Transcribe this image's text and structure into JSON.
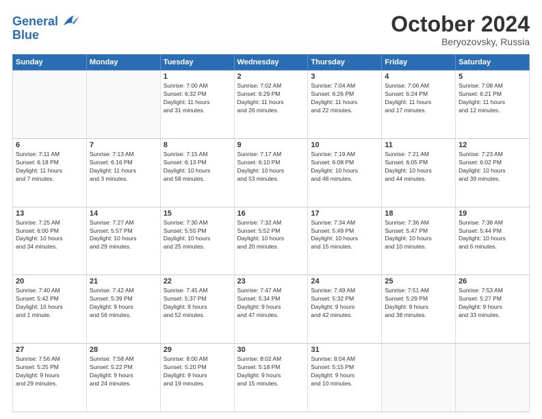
{
  "header": {
    "logo_line1": "General",
    "logo_line2": "Blue",
    "month": "October 2024",
    "location": "Beryozovsky, Russia"
  },
  "days_of_week": [
    "Sunday",
    "Monday",
    "Tuesday",
    "Wednesday",
    "Thursday",
    "Friday",
    "Saturday"
  ],
  "weeks": [
    [
      {
        "day": "",
        "info": ""
      },
      {
        "day": "",
        "info": ""
      },
      {
        "day": "1",
        "info": "Sunrise: 7:00 AM\nSunset: 6:32 PM\nDaylight: 11 hours\nand 31 minutes."
      },
      {
        "day": "2",
        "info": "Sunrise: 7:02 AM\nSunset: 6:29 PM\nDaylight: 11 hours\nand 26 minutes."
      },
      {
        "day": "3",
        "info": "Sunrise: 7:04 AM\nSunset: 6:26 PM\nDaylight: 11 hours\nand 22 minutes."
      },
      {
        "day": "4",
        "info": "Sunrise: 7:06 AM\nSunset: 6:24 PM\nDaylight: 11 hours\nand 17 minutes."
      },
      {
        "day": "5",
        "info": "Sunrise: 7:08 AM\nSunset: 6:21 PM\nDaylight: 11 hours\nand 12 minutes."
      }
    ],
    [
      {
        "day": "6",
        "info": "Sunrise: 7:11 AM\nSunset: 6:18 PM\nDaylight: 11 hours\nand 7 minutes."
      },
      {
        "day": "7",
        "info": "Sunrise: 7:13 AM\nSunset: 6:16 PM\nDaylight: 11 hours\nand 3 minutes."
      },
      {
        "day": "8",
        "info": "Sunrise: 7:15 AM\nSunset: 6:13 PM\nDaylight: 10 hours\nand 58 minutes."
      },
      {
        "day": "9",
        "info": "Sunrise: 7:17 AM\nSunset: 6:10 PM\nDaylight: 10 hours\nand 53 minutes."
      },
      {
        "day": "10",
        "info": "Sunrise: 7:19 AM\nSunset: 6:08 PM\nDaylight: 10 hours\nand 48 minutes."
      },
      {
        "day": "11",
        "info": "Sunrise: 7:21 AM\nSunset: 6:05 PM\nDaylight: 10 hours\nand 44 minutes."
      },
      {
        "day": "12",
        "info": "Sunrise: 7:23 AM\nSunset: 6:02 PM\nDaylight: 10 hours\nand 39 minutes."
      }
    ],
    [
      {
        "day": "13",
        "info": "Sunrise: 7:25 AM\nSunset: 6:00 PM\nDaylight: 10 hours\nand 34 minutes."
      },
      {
        "day": "14",
        "info": "Sunrise: 7:27 AM\nSunset: 5:57 PM\nDaylight: 10 hours\nand 29 minutes."
      },
      {
        "day": "15",
        "info": "Sunrise: 7:30 AM\nSunset: 5:55 PM\nDaylight: 10 hours\nand 25 minutes."
      },
      {
        "day": "16",
        "info": "Sunrise: 7:32 AM\nSunset: 5:52 PM\nDaylight: 10 hours\nand 20 minutes."
      },
      {
        "day": "17",
        "info": "Sunrise: 7:34 AM\nSunset: 5:49 PM\nDaylight: 10 hours\nand 15 minutes."
      },
      {
        "day": "18",
        "info": "Sunrise: 7:36 AM\nSunset: 5:47 PM\nDaylight: 10 hours\nand 10 minutes."
      },
      {
        "day": "19",
        "info": "Sunrise: 7:38 AM\nSunset: 5:44 PM\nDaylight: 10 hours\nand 6 minutes."
      }
    ],
    [
      {
        "day": "20",
        "info": "Sunrise: 7:40 AM\nSunset: 5:42 PM\nDaylight: 10 hours\nand 1 minute."
      },
      {
        "day": "21",
        "info": "Sunrise: 7:42 AM\nSunset: 5:39 PM\nDaylight: 9 hours\nand 56 minutes."
      },
      {
        "day": "22",
        "info": "Sunrise: 7:45 AM\nSunset: 5:37 PM\nDaylight: 9 hours\nand 52 minutes."
      },
      {
        "day": "23",
        "info": "Sunrise: 7:47 AM\nSunset: 5:34 PM\nDaylight: 9 hours\nand 47 minutes."
      },
      {
        "day": "24",
        "info": "Sunrise: 7:49 AM\nSunset: 5:32 PM\nDaylight: 9 hours\nand 42 minutes."
      },
      {
        "day": "25",
        "info": "Sunrise: 7:51 AM\nSunset: 5:29 PM\nDaylight: 9 hours\nand 38 minutes."
      },
      {
        "day": "26",
        "info": "Sunrise: 7:53 AM\nSunset: 5:27 PM\nDaylight: 9 hours\nand 33 minutes."
      }
    ],
    [
      {
        "day": "27",
        "info": "Sunrise: 7:56 AM\nSunset: 5:25 PM\nDaylight: 9 hours\nand 29 minutes."
      },
      {
        "day": "28",
        "info": "Sunrise: 7:58 AM\nSunset: 5:22 PM\nDaylight: 9 hours\nand 24 minutes."
      },
      {
        "day": "29",
        "info": "Sunrise: 8:00 AM\nSunset: 5:20 PM\nDaylight: 9 hours\nand 19 minutes."
      },
      {
        "day": "30",
        "info": "Sunrise: 8:02 AM\nSunset: 5:18 PM\nDaylight: 9 hours\nand 15 minutes."
      },
      {
        "day": "31",
        "info": "Sunrise: 8:04 AM\nSunset: 5:15 PM\nDaylight: 9 hours\nand 10 minutes."
      },
      {
        "day": "",
        "info": ""
      },
      {
        "day": "",
        "info": ""
      }
    ]
  ]
}
